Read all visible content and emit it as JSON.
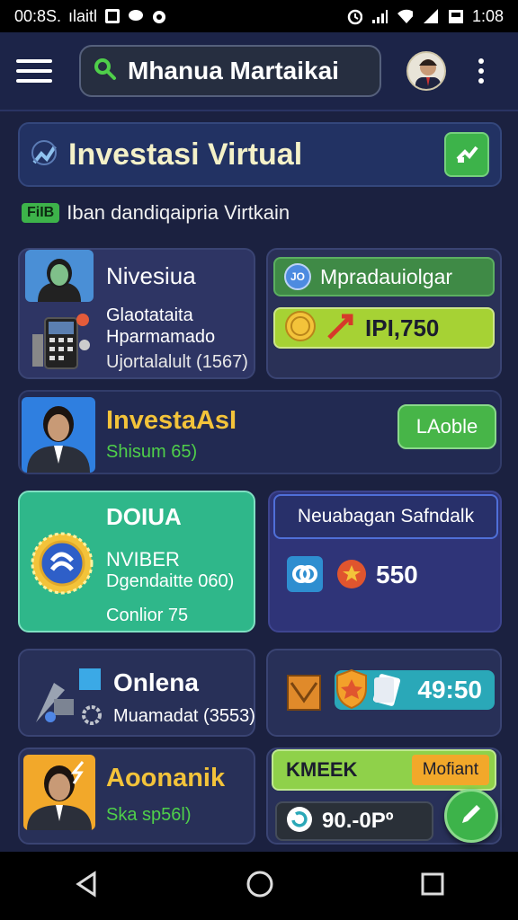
{
  "status_bar": {
    "time_left": "00:8S.",
    "carrier": "ılaitl",
    "time_right": "1:08"
  },
  "search": {
    "query": "Mhanua Martaikai"
  },
  "title_card": {
    "title": "Investasi Virtual"
  },
  "subtitle": {
    "tag": "FiIB",
    "text": "Iban dandiqaipria Virtkain"
  },
  "card1": {
    "title": "Nivesiua",
    "line1": "Glaotataita",
    "line2": "Hparmamado",
    "line3": "Ujortalalult (1567)"
  },
  "card2": {
    "label": "Mpradauiolgar",
    "value": "IPI,750",
    "badge": "JO"
  },
  "card3": {
    "title": "InvestaAsI",
    "sub": "Shisum 65)",
    "button": "LAoble"
  },
  "card4": {
    "title": "DOIUA",
    "line1": "NVIBER",
    "line2": "Dgendaitte 060)",
    "line3": "Conlior 75"
  },
  "card5": {
    "title": "Neuabagan Safndalk",
    "value": "550"
  },
  "card6": {
    "title": "Onlena",
    "line1": "Muamadat (3553)"
  },
  "card7": {
    "value": "49:50"
  },
  "card8": {
    "title": "Aoonanik",
    "sub": "Ska sp56l)"
  },
  "card9": {
    "label": "KMEEK",
    "tag": "Mofiant",
    "value": "90.-0Pº"
  },
  "colors": {
    "accent_green": "#47b548",
    "panel": "#2a3157",
    "teal_card": "#2fb78a",
    "gold": "#f3c33a"
  }
}
